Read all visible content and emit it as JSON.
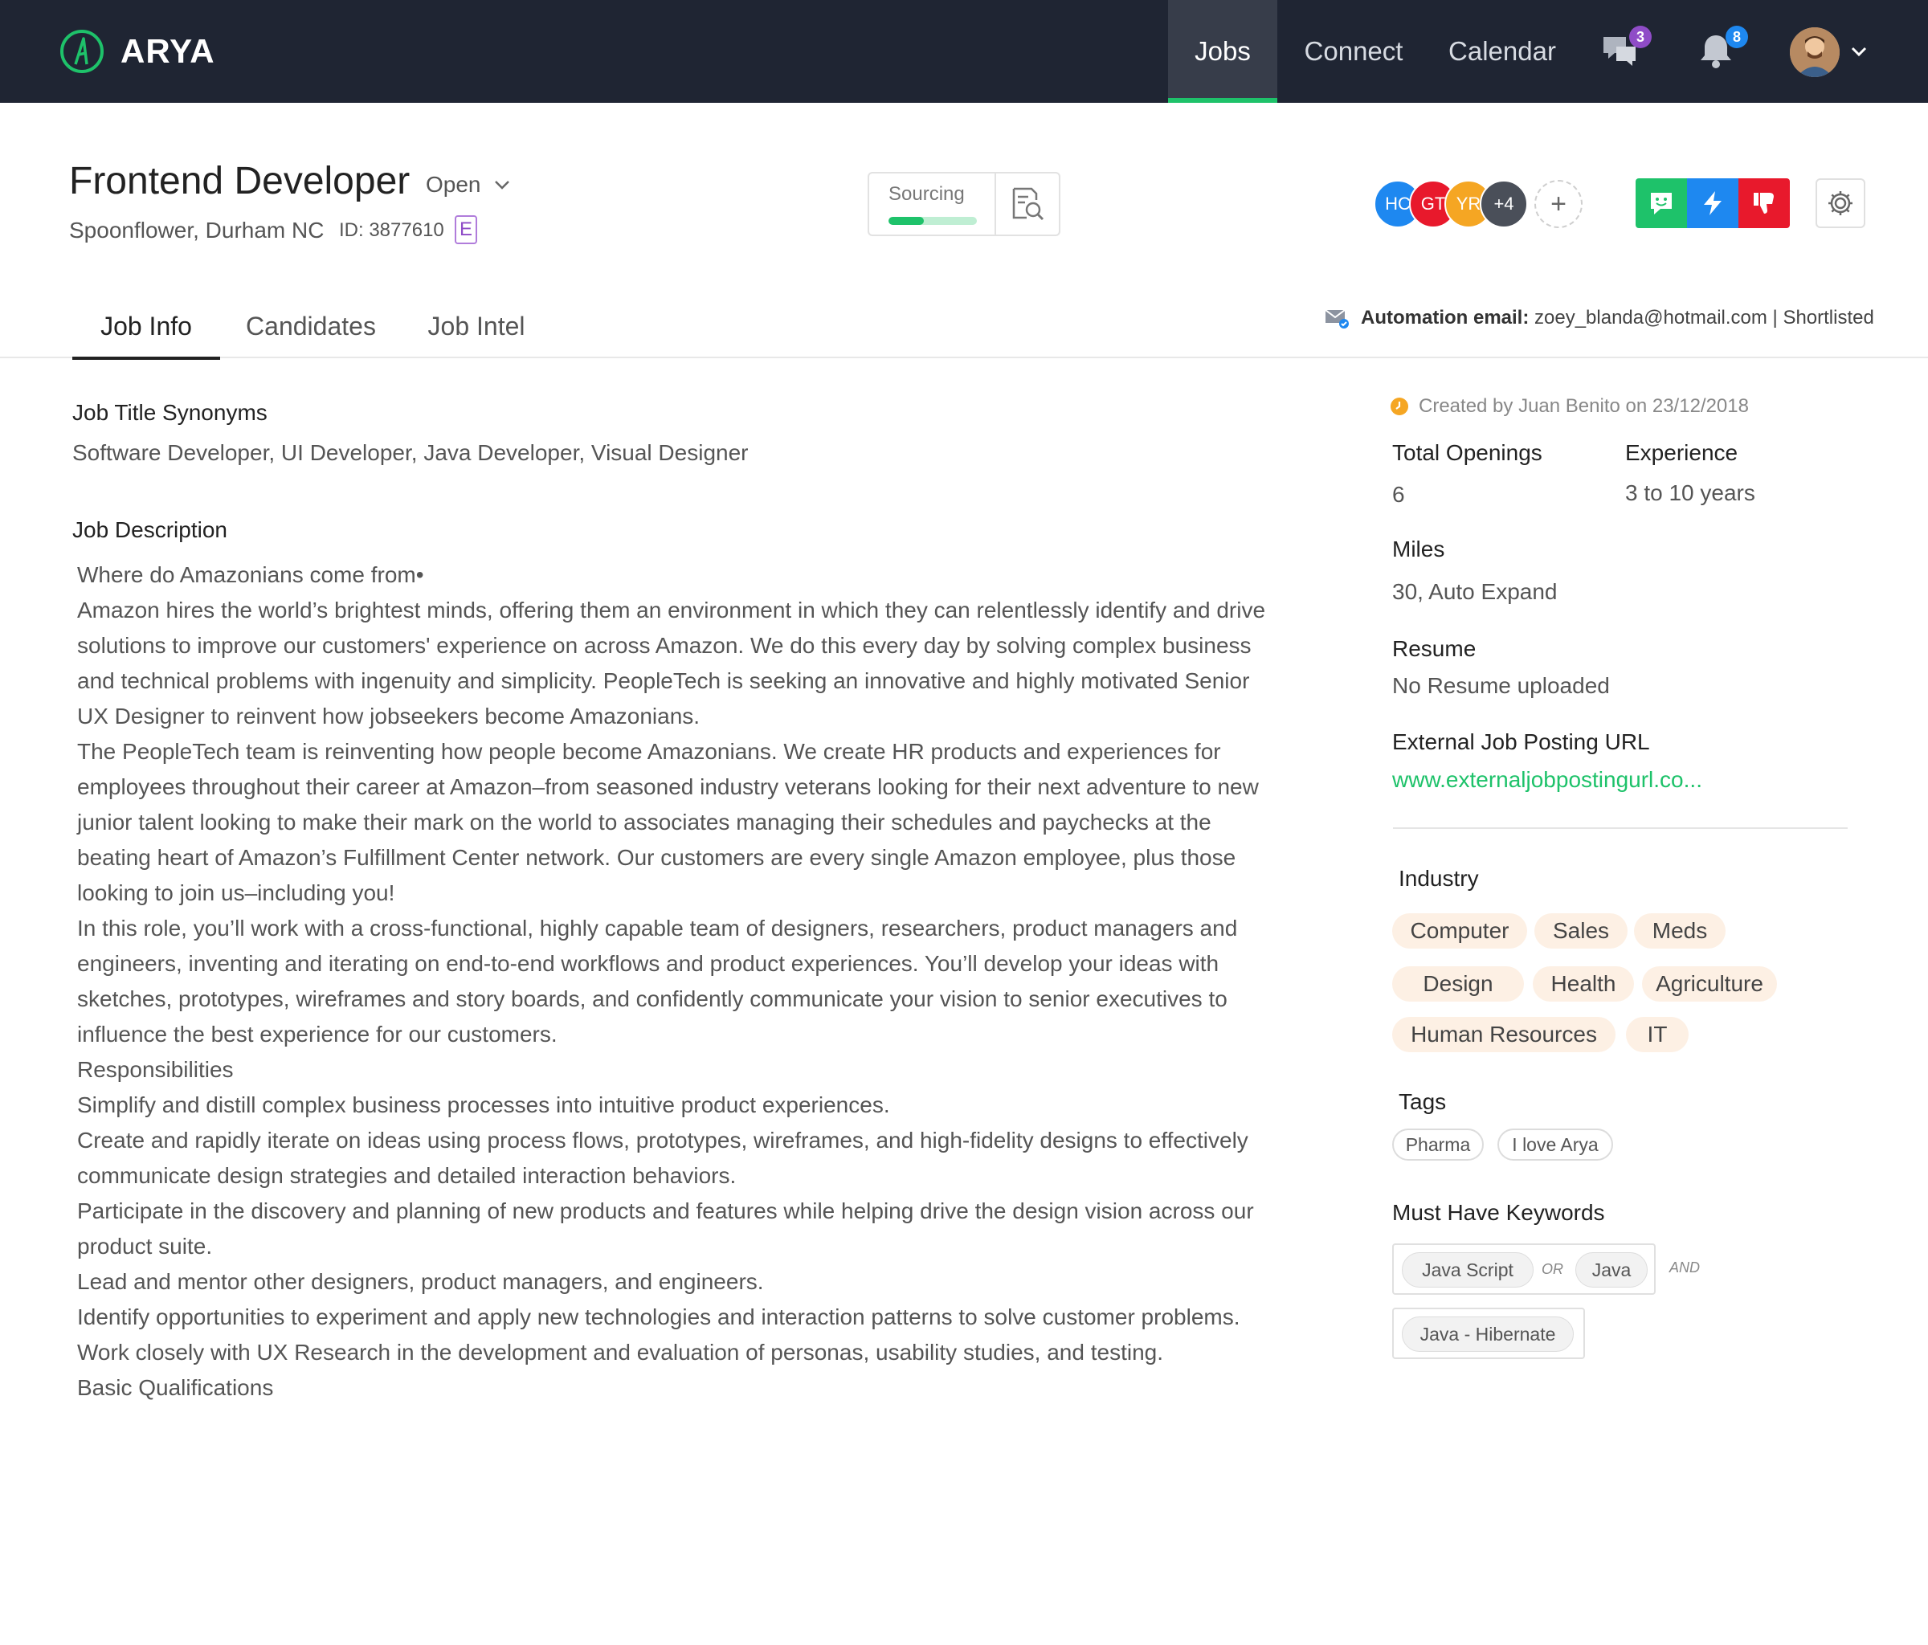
{
  "colors": {
    "nav_bg": "#1f2533",
    "accent_green": "#1ec26a",
    "chip_peach": "#fdf0e4",
    "purple": "#8f4cc7",
    "blue": "#1e88f0",
    "red": "#e8192c"
  },
  "nav": {
    "brand": "ARYA",
    "links": [
      "Jobs",
      "Connect",
      "Calendar"
    ],
    "active_link": "Jobs",
    "chat_badge": "3",
    "notification_badge": "8",
    "icons": [
      "chat-icon",
      "bell-icon",
      "avatar",
      "chevron-down-icon"
    ]
  },
  "job": {
    "title": "Frontend Developer",
    "status": "Open",
    "location": "Spoonflower, Durham NC",
    "id_text": "ID: 3877610",
    "tag_letter": "E",
    "sourcing_label": "Sourcing",
    "sourcing_progress": 0.4,
    "recruiters": [
      "HC",
      "GT",
      "YR",
      "+4"
    ],
    "add_label": "+"
  },
  "tabs": [
    "Job Info",
    "Candidates",
    "Job Intel"
  ],
  "active_tab": "Job Info",
  "automation": {
    "label": "Automation email:",
    "value": "zoey_blanda@hotmail.com | Shortlisted"
  },
  "left": {
    "synonyms_label": "Job Title Synonyms",
    "synonyms": "Software Developer, UI Developer, Java Developer, Visual Designer",
    "description_label": "Job Description",
    "description": [
      "Where do Amazonians come from•",
      "Amazon hires the world’s brightest minds, offering them an environment in which they can relentlessly identify and drive solutions to improve our customers' experience on across Amazon. We do this every day by solving complex business and technical problems with ingenuity and simplicity. PeopleTech is seeking an innovative and highly motivated Senior UX Designer to reinvent how jobseekers become Amazonians.",
      "The PeopleTech team is reinventing how people become Amazonians. We create HR products and experiences for employees throughout their career at Amazon–from seasoned industry veterans looking for their next adventure to new junior talent looking to make their mark on the world to associates managing their schedules and paychecks at the beating heart of Amazon’s Fulfillment Center network. Our customers are every single Amazon employee, plus those looking to join us–including you!",
      "In this role, you’ll work with a cross-functional, highly capable team of designers, researchers, product managers and engineers, inventing and iterating on end-to-end workflows and product experiences. You’ll develop your ideas with sketches, prototypes, wireframes and story boards, and confidently communicate your vision to senior executives to influence the best experience for our customers.",
      "Responsibilities",
      "Simplify and distill complex business processes into intuitive product experiences.",
      "Create and rapidly iterate on ideas using process flows, prototypes, wireframes, and high-fidelity designs to effectively communicate design strategies and detailed interaction behaviors.",
      "Participate in the discovery and planning of new products and features while helping drive the design vision across our product suite.",
      "Lead and mentor other designers, product managers, and engineers.",
      "Identify opportunities to experiment and apply new technologies and interaction patterns to solve customer problems.",
      "Work closely with UX Research in the development and evaluation of personas, usability studies, and testing.",
      "Basic Qualifications"
    ]
  },
  "right": {
    "created": "Created by Juan Benito on 23/12/2018",
    "total_openings_label": "Total Openings",
    "total_openings": "6",
    "experience_label": "Experience",
    "experience": "3 to 10 years",
    "miles_label": "Miles",
    "miles": "30, Auto Expand",
    "resume_label": "Resume",
    "resume": "No Resume uploaded",
    "url_label": "External Job Posting URL",
    "url": "www.externaljobpostingurl.co...",
    "industry_label": "Industry",
    "industries": [
      "Computer",
      "Sales",
      "Meds",
      "Design",
      "Health",
      "Agriculture",
      "Human Resources",
      "IT"
    ],
    "tags_label": "Tags",
    "tags": [
      "Pharma",
      "I love Arya"
    ],
    "keywords_label": "Must Have Keywords",
    "keywords": [
      "Java Script",
      "Java",
      "Java - Hibernate"
    ],
    "or_label": "OR",
    "and_label": "AND"
  }
}
